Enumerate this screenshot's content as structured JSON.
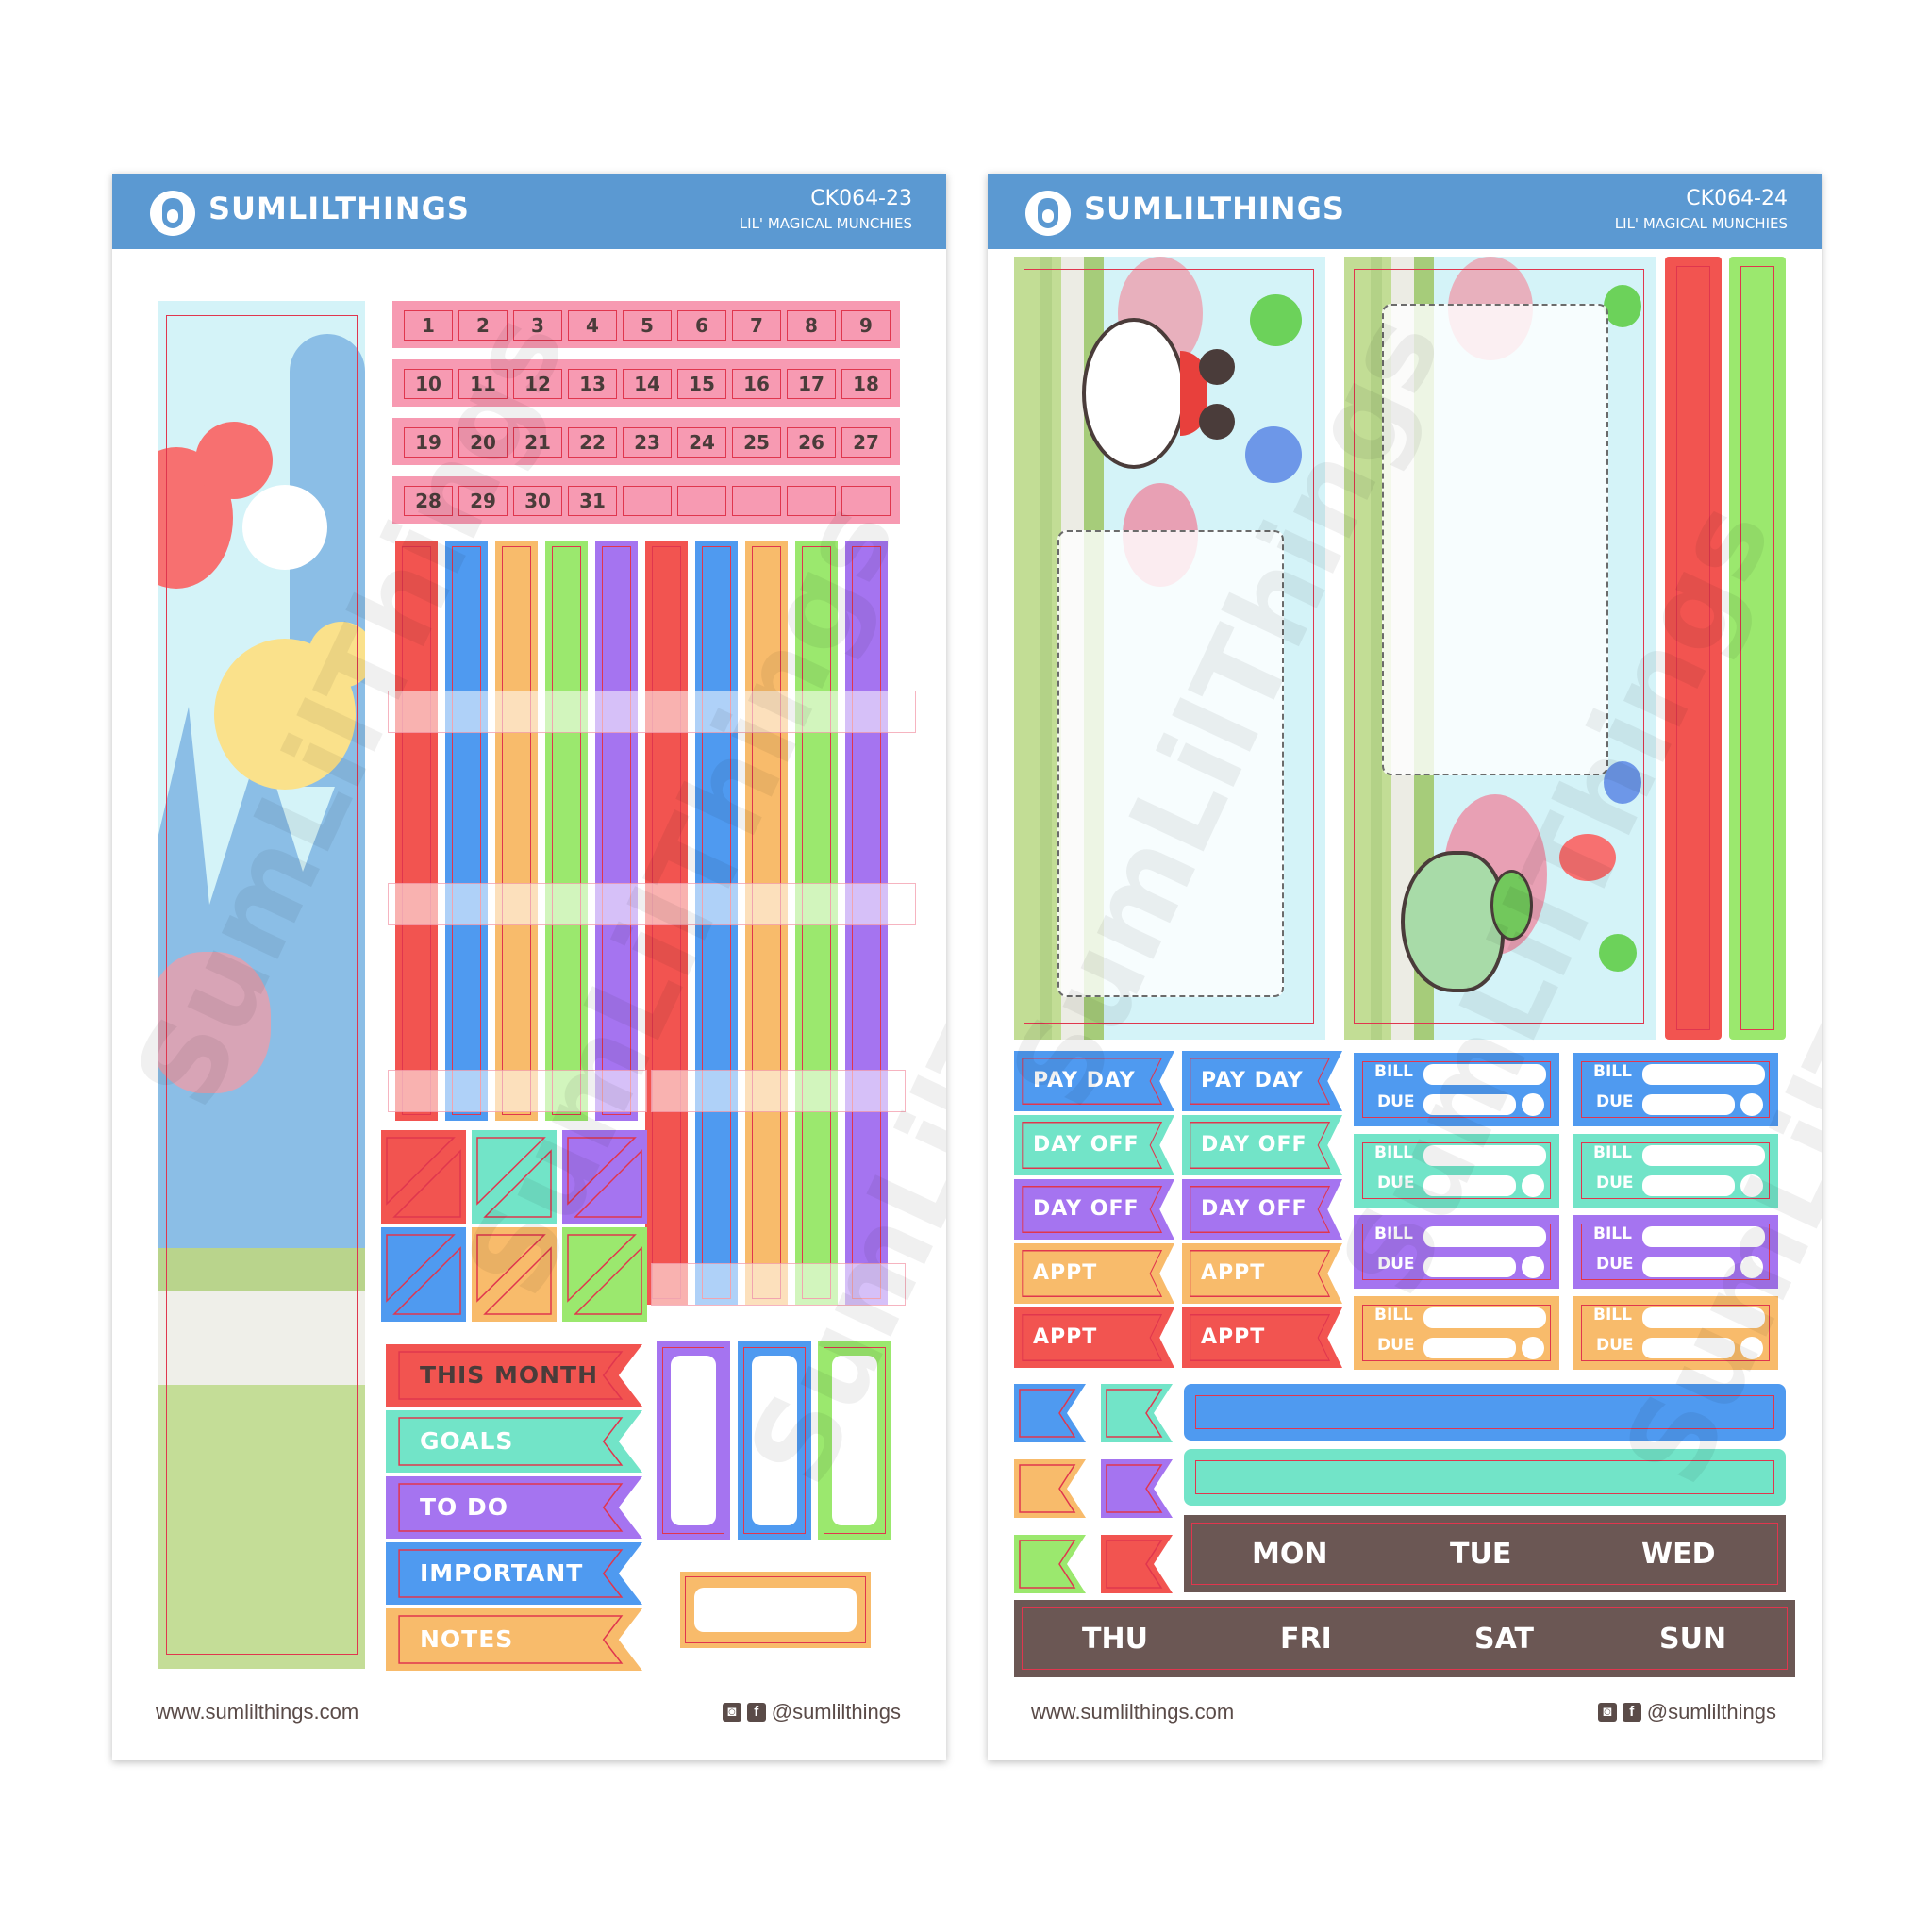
{
  "colors": {
    "header": "#5b99d2",
    "red": "#f25450",
    "blue": "#4f9af0",
    "orange": "#f8bb6b",
    "green": "#9be86e",
    "purple": "#a574f0",
    "teal": "#72e4c8",
    "pink": "#f79ab2",
    "brown": "#6b5754",
    "cut": "#e0364e"
  },
  "brand": "SUMLILTHINGS",
  "sheets": [
    {
      "code": "CK064-23",
      "subtitle": "LIL' MAGICAL MUNCHIES",
      "url": "www.sumlilthings.com",
      "social": "@sumlilthings"
    },
    {
      "code": "CK064-24",
      "subtitle": "LIL' MAGICAL MUNCHIES",
      "url": "www.sumlilthings.com",
      "social": "@sumlilthings"
    }
  ],
  "watermark": "SumLilThings",
  "social_icons": {
    "instagram": "instagram-icon",
    "facebook": "facebook-icon",
    "ig_glyph": "◙",
    "fb_glyph": "f"
  },
  "date_rows": [
    [
      "1",
      "2",
      "3",
      "4",
      "5",
      "6",
      "7",
      "8",
      "9"
    ],
    [
      "10",
      "11",
      "12",
      "13",
      "14",
      "15",
      "16",
      "17",
      "18"
    ],
    [
      "19",
      "20",
      "21",
      "22",
      "23",
      "24",
      "25",
      "26",
      "27"
    ],
    [
      "28",
      "29",
      "30",
      "31",
      "",
      "",
      "",
      "",
      ""
    ]
  ],
  "sheet1_flags": [
    {
      "label": "THIS MONTH",
      "color": "red",
      "dark_text": true
    },
    {
      "label": "GOALS",
      "color": "teal"
    },
    {
      "label": "TO DO",
      "color": "purple"
    },
    {
      "label": "IMPORTANT",
      "color": "blue"
    },
    {
      "label": "NOTES",
      "color": "orange"
    }
  ],
  "sheet2_flags": [
    {
      "label": "PAY DAY",
      "color": "blue"
    },
    {
      "label": "DAY OFF",
      "color": "teal"
    },
    {
      "label": "DAY OFF",
      "color": "purple"
    },
    {
      "label": "APPT",
      "color": "orange"
    },
    {
      "label": "APPT",
      "color": "red"
    }
  ],
  "bill": {
    "bill_label": "BILL",
    "due_label": "DUE",
    "colors": [
      "blue",
      "teal",
      "purple",
      "orange"
    ]
  },
  "days_top": [
    "MON",
    "TUE",
    "WED"
  ],
  "days_bottom": [
    "THU",
    "FRI",
    "SAT",
    "SUN"
  ]
}
